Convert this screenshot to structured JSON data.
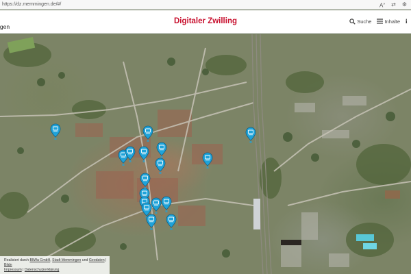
{
  "browser": {
    "url": "https://dz.memmingen.de/#/",
    "icons": [
      "read-aloud-icon",
      "translate-icon",
      "settings-icon"
    ]
  },
  "header": {
    "brand_fragment": "igen",
    "title": "Digitaler Zwilling",
    "title_color": "#c8102e",
    "search_label": "Suche",
    "contents_label": "Inhalte",
    "info_label": "i"
  },
  "map": {
    "marker_color": "#1fa3d9",
    "marker_count": 17
  },
  "attribution": {
    "prefix": "Realisiert durch ",
    "link_bliwa": "BliWa GmbH",
    "sep1": ", ",
    "link_stadt": "Stadt Memmingen",
    "sep2": " und ",
    "link_geodaten": "Geodaten",
    "sep3": " | ",
    "link_bildnachweis": "Bildn",
    "link_impressum": "Impressum",
    "sep4": " | ",
    "link_datenschutz": "Datenschutzerklärung"
  }
}
